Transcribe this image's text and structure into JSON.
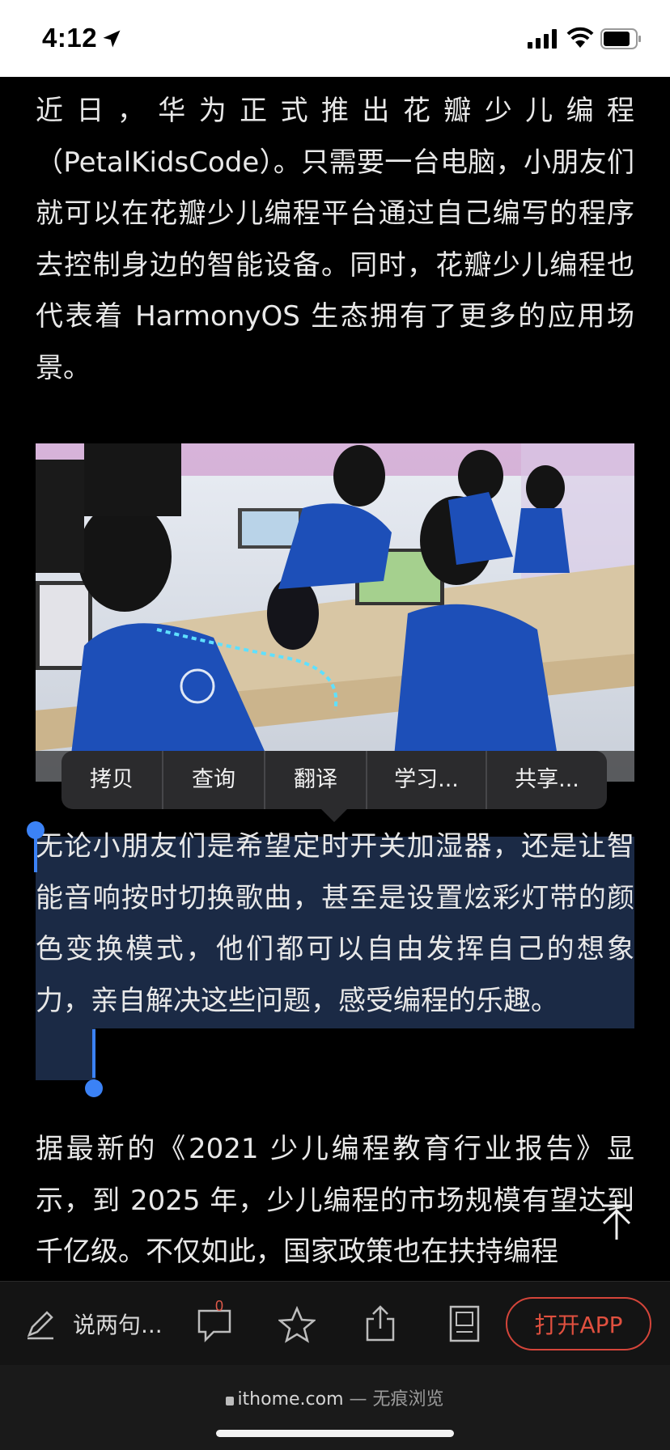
{
  "status_bar": {
    "time": "4:12",
    "icons": [
      "location-arrow-icon",
      "cellular-signal-icon",
      "wifi-icon",
      "battery-icon"
    ]
  },
  "article": {
    "paragraph_1": "近日，华为正式推出花瓣少儿编程（PetalKidsCode）。只需要一台电脑，小朋友们就可以在花瓣少儿编程平台通过自己编写的程序去控制身边的智能设备。同时，花瓣少儿编程也代表着 HarmonyOS 生态拥有了更多的应用场景。",
    "paragraph_2_selected": "无论小朋友们是希望定时开关加湿器，还是让智能音响按时切换歌曲，甚至是设置炫彩灯带的颜色变换模式，他们都可以自由发挥自己的想象力，亲自解决这些问题，感受编程的乐趣。",
    "paragraph_3": "据最新的《2021 少儿编程教育行业报告》显示，到 2025 年，少儿编程的市场规模有望达到千亿级。不仅如此，国家政策也在扶持编程"
  },
  "context_menu": {
    "items": [
      "拷贝",
      "查询",
      "翻译",
      "学习...",
      "共享..."
    ]
  },
  "toolbar": {
    "comment_placeholder": "说两句...",
    "comment_count": "0",
    "open_app_label": "打开APP"
  },
  "browser": {
    "domain": "ithome.com",
    "separator": " — ",
    "mode": "无痕浏览"
  },
  "colors": {
    "selection": "#1b2a45",
    "handle": "#3b82f6",
    "accent": "#d4453a"
  }
}
